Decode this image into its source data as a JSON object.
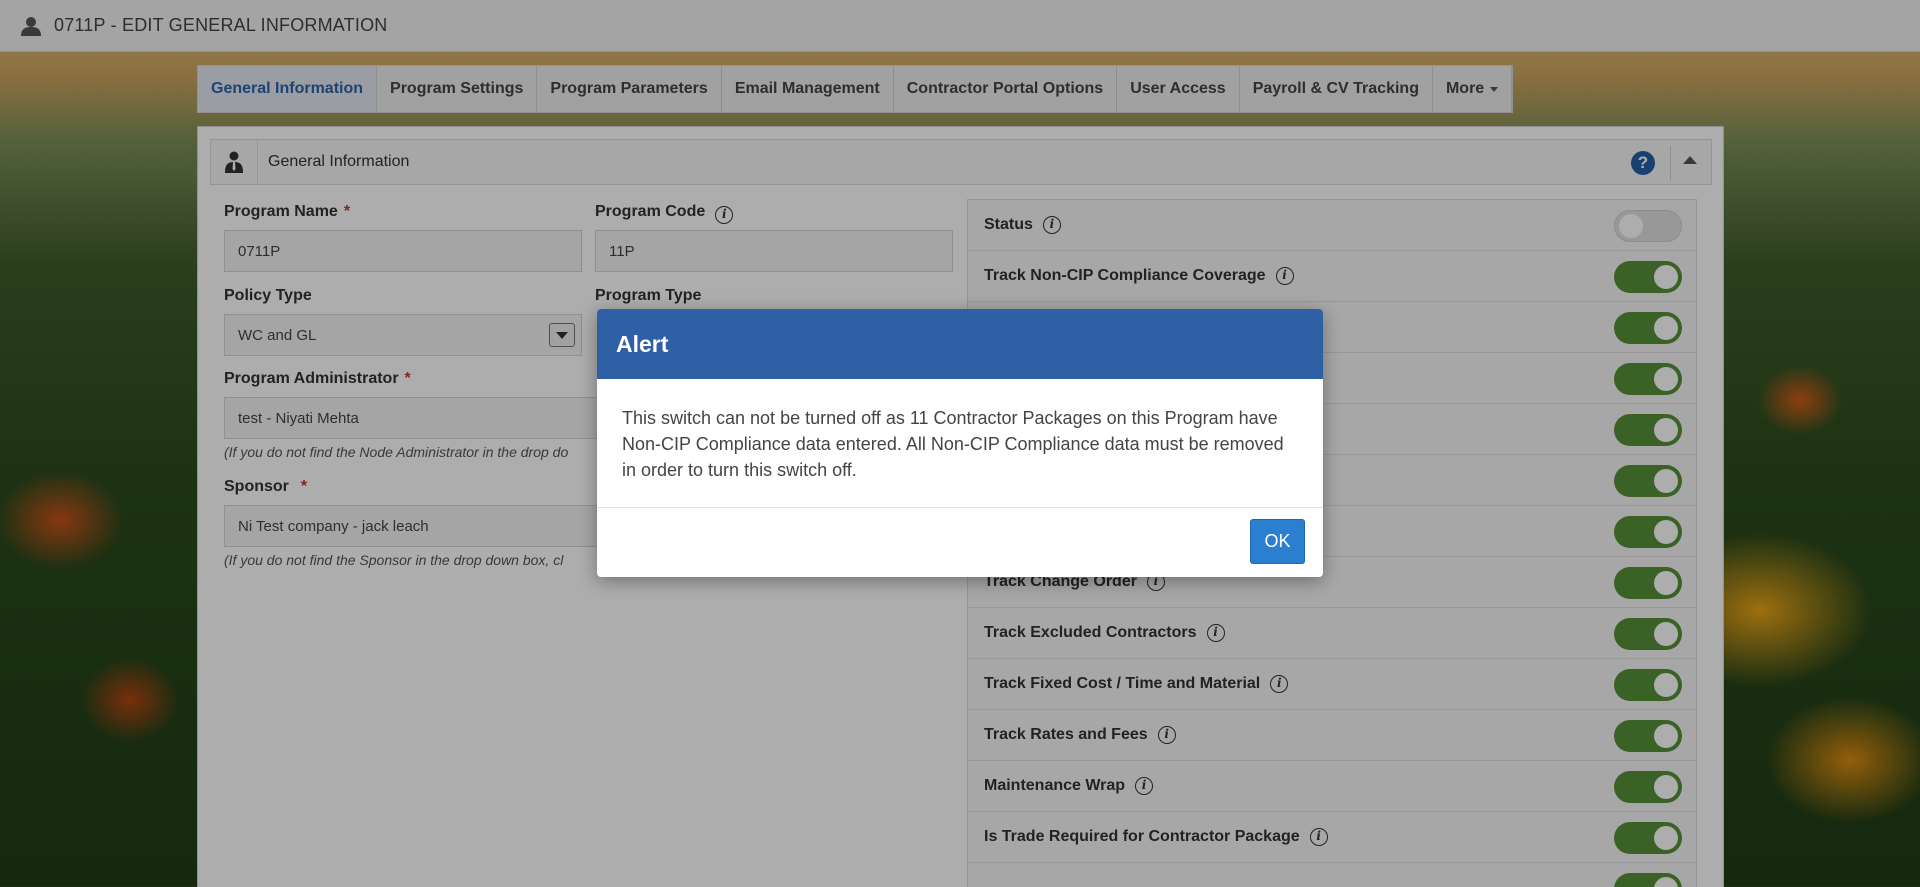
{
  "header": {
    "title": "0711P - EDIT GENERAL INFORMATION",
    "user_icon": "user-icon"
  },
  "tabs": [
    {
      "label": "General Information",
      "active": true
    },
    {
      "label": "Program Settings"
    },
    {
      "label": "Program Parameters"
    },
    {
      "label": "Email Management"
    },
    {
      "label": "Contractor Portal Options"
    },
    {
      "label": "User Access"
    },
    {
      "label": "Payroll & CV Tracking"
    },
    {
      "label": "More"
    }
  ],
  "panel": {
    "title": "General Information",
    "help_icon": "question-circle-icon",
    "collapse_icon": "chevron-up-icon"
  },
  "form": {
    "program_name": {
      "label": "Program Name",
      "required": "*",
      "value": "0711P"
    },
    "program_code": {
      "label": "Program Code",
      "value": "11P"
    },
    "policy_type": {
      "label": "Policy Type",
      "value": "WC and GL"
    },
    "program_type": {
      "label": "Program Type"
    },
    "program_admin": {
      "label": "Program Administrator",
      "required": "*",
      "value": "test - Niyati Mehta",
      "hint": "(If you do not find the Node Administrator in the drop do"
    },
    "sponsor": {
      "label": "Sponsor",
      "required": "*",
      "value": "Ni Test company - jack leach",
      "hint": "(If you do not find the Sponsor in the drop down box,  cl"
    }
  },
  "settings": [
    {
      "label": "Status",
      "on": false
    },
    {
      "label": "Track Non-CIP Compliance Coverage",
      "on": true
    },
    {
      "label": "",
      "on": true
    },
    {
      "label": "",
      "on": true
    },
    {
      "label": "",
      "on": true
    },
    {
      "label": "",
      "on": true
    },
    {
      "label": "",
      "on": true
    },
    {
      "label": "Track Change Order",
      "on": true
    },
    {
      "label": "Track Excluded Contractors",
      "on": true
    },
    {
      "label": "Track Fixed Cost / Time and Material",
      "on": true
    },
    {
      "label": "Track Rates and Fees",
      "on": true
    },
    {
      "label": "Maintenance Wrap",
      "on": true
    },
    {
      "label": "Is Trade Required for Contractor Package",
      "on": true
    }
  ],
  "modal": {
    "title": "Alert",
    "message": "This switch can not be turned off as 11 Contractor Packages on this Program have Non-CIP Compliance data entered. All Non-CIP Compliance data must be removed in order to turn this switch off.",
    "ok_label": "OK"
  },
  "colors": {
    "accent": "#2f60a6",
    "toggle_on": "#56913a",
    "required": "#c0392b"
  }
}
